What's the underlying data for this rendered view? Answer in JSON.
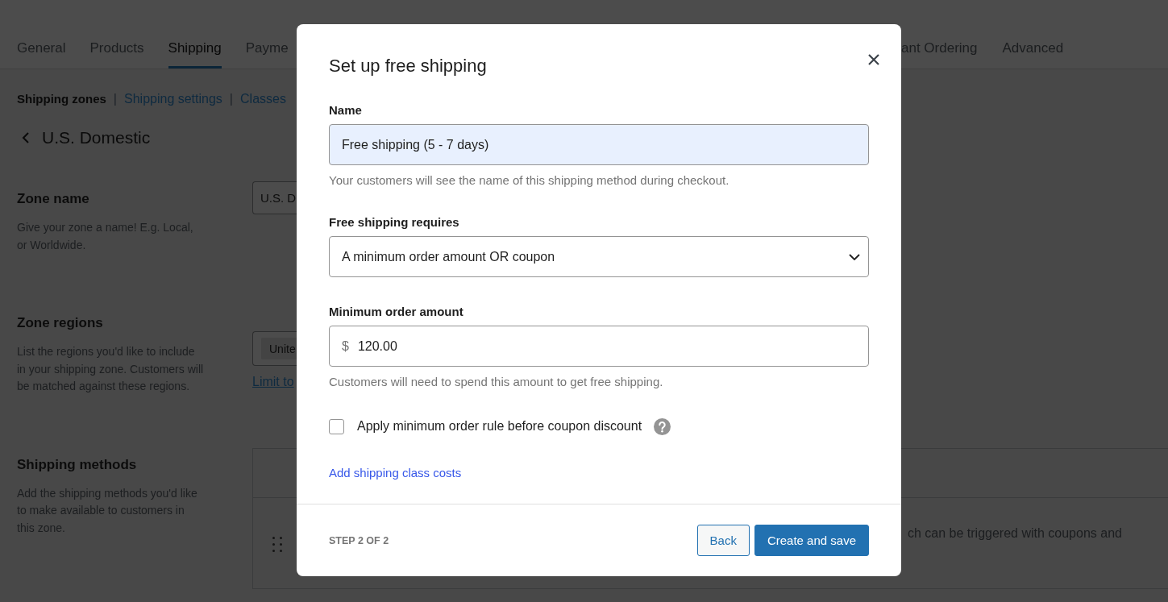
{
  "tabs": {
    "left": [
      {
        "label": "General",
        "selected": false
      },
      {
        "label": "Products",
        "selected": false
      },
      {
        "label": "Shipping",
        "selected": true
      },
      {
        "label": "Payme",
        "selected": false
      }
    ],
    "right": [
      {
        "label": "ant Ordering",
        "selected": false
      },
      {
        "label": "Advanced",
        "selected": false
      }
    ]
  },
  "subnav": [
    {
      "kind": "link",
      "label": "Shipping zones",
      "selected": true
    },
    {
      "kind": "separator",
      "label": "|"
    },
    {
      "kind": "link",
      "label": "Shipping settings",
      "selected": false
    },
    {
      "kind": "separator",
      "label": "|"
    },
    {
      "kind": "link",
      "label": "Classes",
      "selected": false
    }
  ],
  "page_heading": "U.S. Domestic",
  "sections": [
    {
      "kind": "name",
      "title": "Zone name",
      "description": "Give your zone a name! E.g. Local, or Worldwide.",
      "value": "U.S. D"
    },
    {
      "kind": "regions",
      "title": "Zone regions",
      "description": "List the regions you'd like to include in your shipping zone. Customers will be matched against these regions.",
      "chips": [
        "Unite"
      ],
      "link": "Limit to"
    },
    {
      "kind": "methods",
      "title": "Shipping methods",
      "description": "Add the shipping methods you'd like to make available to customers in this zone.",
      "rows": [
        {
          "description": "ch can be triggered with coupons and"
        }
      ]
    }
  ],
  "dialog": {
    "title": "Set up free shipping",
    "fields": [
      {
        "kind": "text",
        "label": "Name",
        "value": "Free shipping (5 - 7 days)",
        "help": "Your customers will see the name of this shipping method during checkout.",
        "autofilled": true
      },
      {
        "kind": "select",
        "label": "Free shipping requires",
        "value": "A minimum order amount OR coupon",
        "autofilled": false
      },
      {
        "kind": "currency",
        "label": "Minimum order amount",
        "prefix": "$",
        "value": "120.00",
        "help": "Customers will need to spend this amount to get free shipping.",
        "autofilled": false
      }
    ],
    "checkbox": {
      "label": "Apply minimum order rule before coupon discount",
      "checked": false
    },
    "link": "Add shipping class costs",
    "footer": {
      "step": "STEP 2 OF 2",
      "buttons": [
        {
          "kind": "secondary",
          "label": "Back"
        },
        {
          "kind": "primary",
          "label": "Create and save"
        }
      ]
    }
  }
}
